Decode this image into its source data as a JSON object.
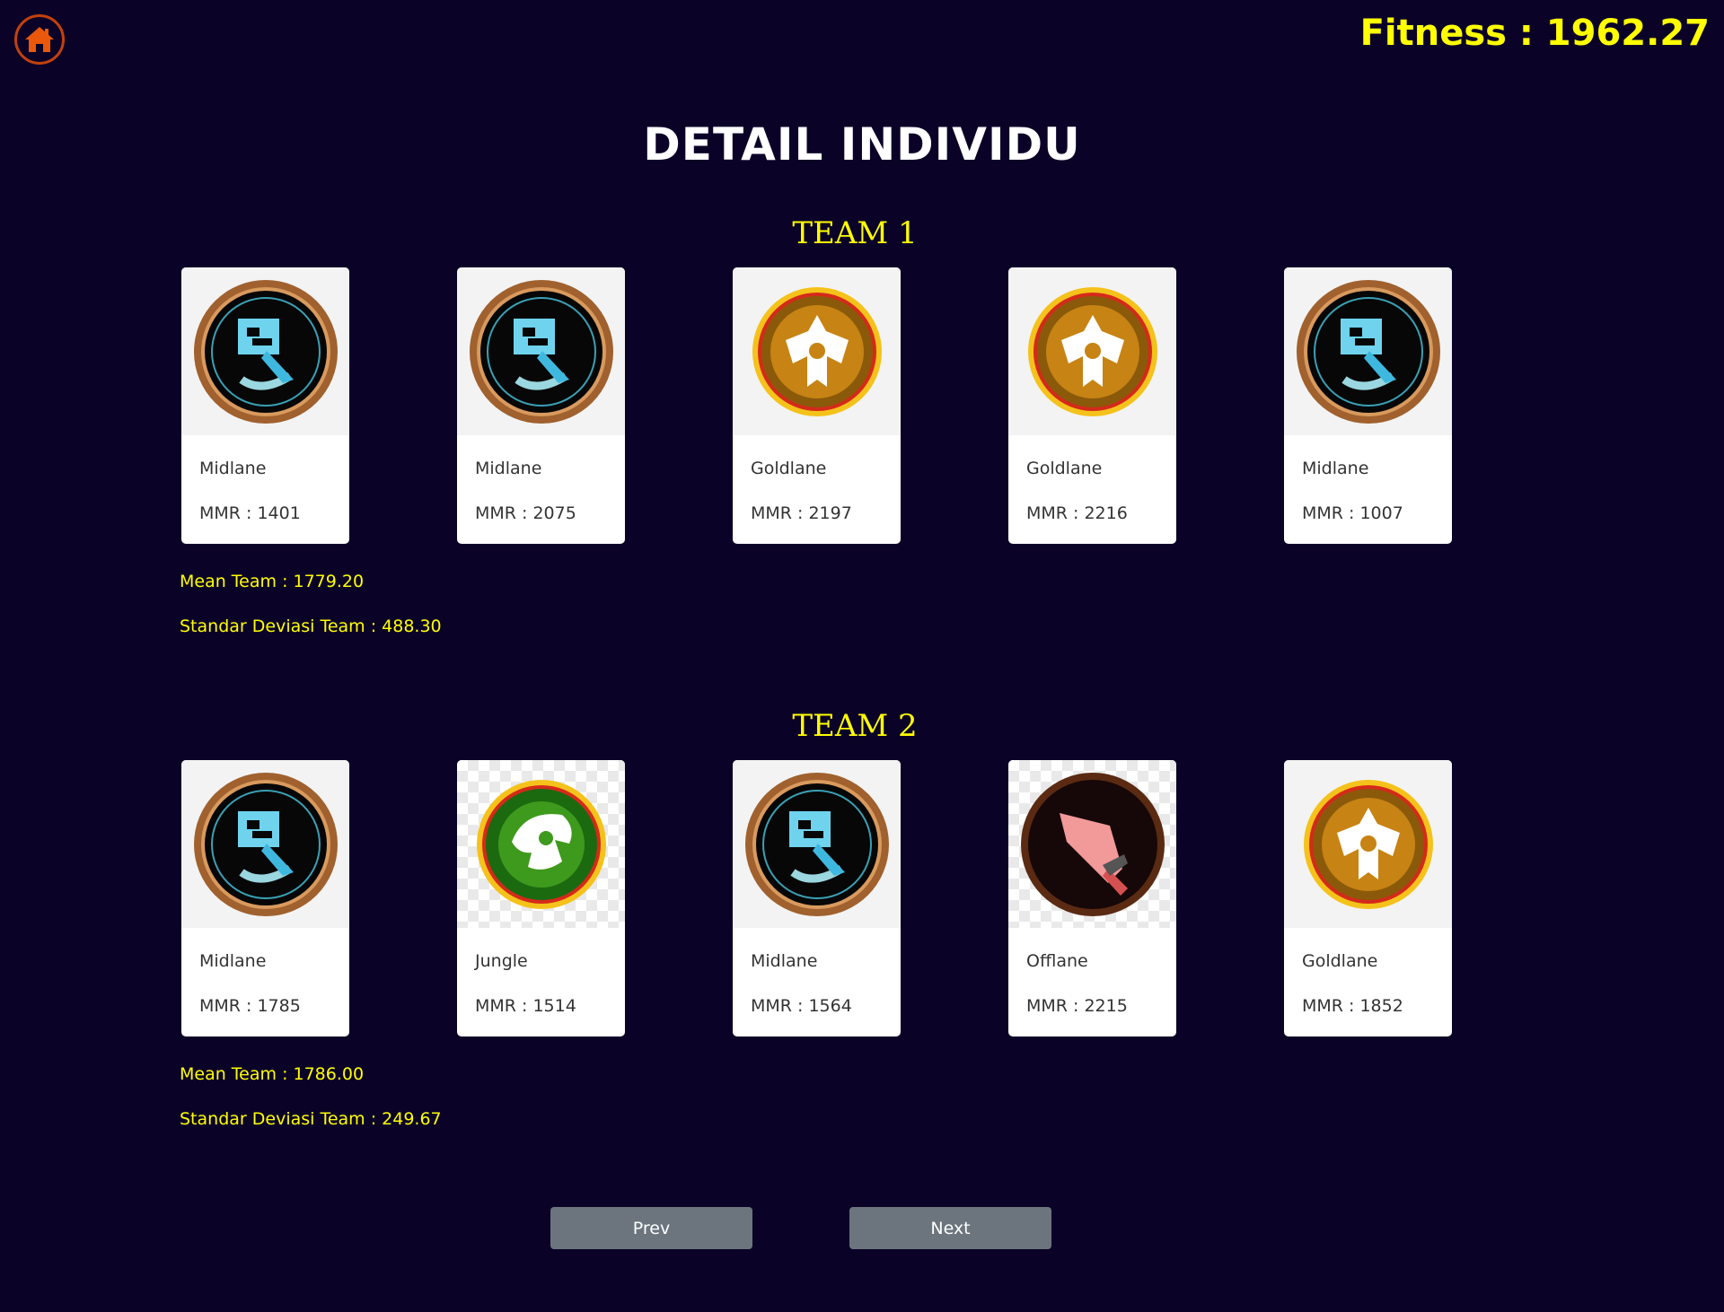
{
  "header": {
    "fitness": "Fitness : 1962.27",
    "title": "DETAIL INDIVIDU",
    "home_icon": "home-icon"
  },
  "teams": [
    {
      "title": "TEAM 1",
      "members": [
        {
          "role": "Midlane",
          "mmr": "MMR : 1401",
          "icon": "mid-icon"
        },
        {
          "role": "Midlane",
          "mmr": "MMR : 2075",
          "icon": "mid-icon"
        },
        {
          "role": "Goldlane",
          "mmr": "MMR : 2197",
          "icon": "gold-icon"
        },
        {
          "role": "Goldlane",
          "mmr": "MMR : 2216",
          "icon": "gold-icon"
        },
        {
          "role": "Midlane",
          "mmr": "MMR : 1007",
          "icon": "mid-icon"
        }
      ],
      "mean": "Mean Team : 1779.20",
      "stdev": "Standar Deviasi Team : 488.30"
    },
    {
      "title": "TEAM 2",
      "members": [
        {
          "role": "Midlane",
          "mmr": "MMR : 1785",
          "icon": "mid-icon"
        },
        {
          "role": "Jungle",
          "mmr": "MMR : 1514",
          "icon": "jungle-icon"
        },
        {
          "role": "Midlane",
          "mmr": "MMR : 1564",
          "icon": "mid-icon"
        },
        {
          "role": "Offlane",
          "mmr": "MMR : 2215",
          "icon": "offlane-icon"
        },
        {
          "role": "Goldlane",
          "mmr": "MMR : 1852",
          "icon": "gold-icon"
        }
      ],
      "mean": "Mean Team : 1786.00",
      "stdev": "Standar Deviasi Team : 249.67"
    }
  ],
  "nav": {
    "prev": "Prev",
    "next": "Next"
  },
  "colors": {
    "background": "#0b0228",
    "accent": "#ffff00",
    "button": "#6c757d",
    "home_border": "#c2410c"
  }
}
